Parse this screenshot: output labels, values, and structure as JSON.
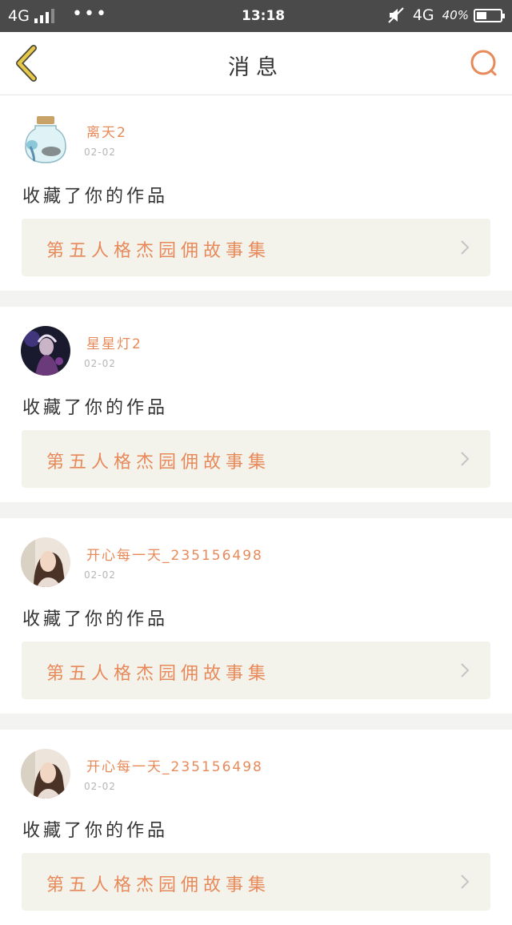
{
  "status_bar": {
    "network_left": "4G",
    "dots": "•••",
    "time": "13:18",
    "network_right": "4G",
    "battery": "40%"
  },
  "header": {
    "title": "消息"
  },
  "messages": [
    {
      "user": "离天2",
      "date": "02-02",
      "action": "收藏了你的作品",
      "work_title": "第五人格杰园佣故事集"
    },
    {
      "user": "星星灯2",
      "date": "02-02",
      "action": "收藏了你的作品",
      "work_title": "第五人格杰园佣故事集"
    },
    {
      "user": "开心每一天_235156498",
      "date": "02-02",
      "action": "收藏了你的作品",
      "work_title": "第五人格杰园佣故事集"
    },
    {
      "user": "开心每一天_235156498",
      "date": "02-02",
      "action": "收藏了你的作品",
      "work_title": "第五人格杰园佣故事集"
    }
  ],
  "colors": {
    "accent": "#e8895a",
    "back_icon": "#e8c84a",
    "status_bar": "#4a4a4a",
    "card_link_bg": "#f3f3ec"
  }
}
